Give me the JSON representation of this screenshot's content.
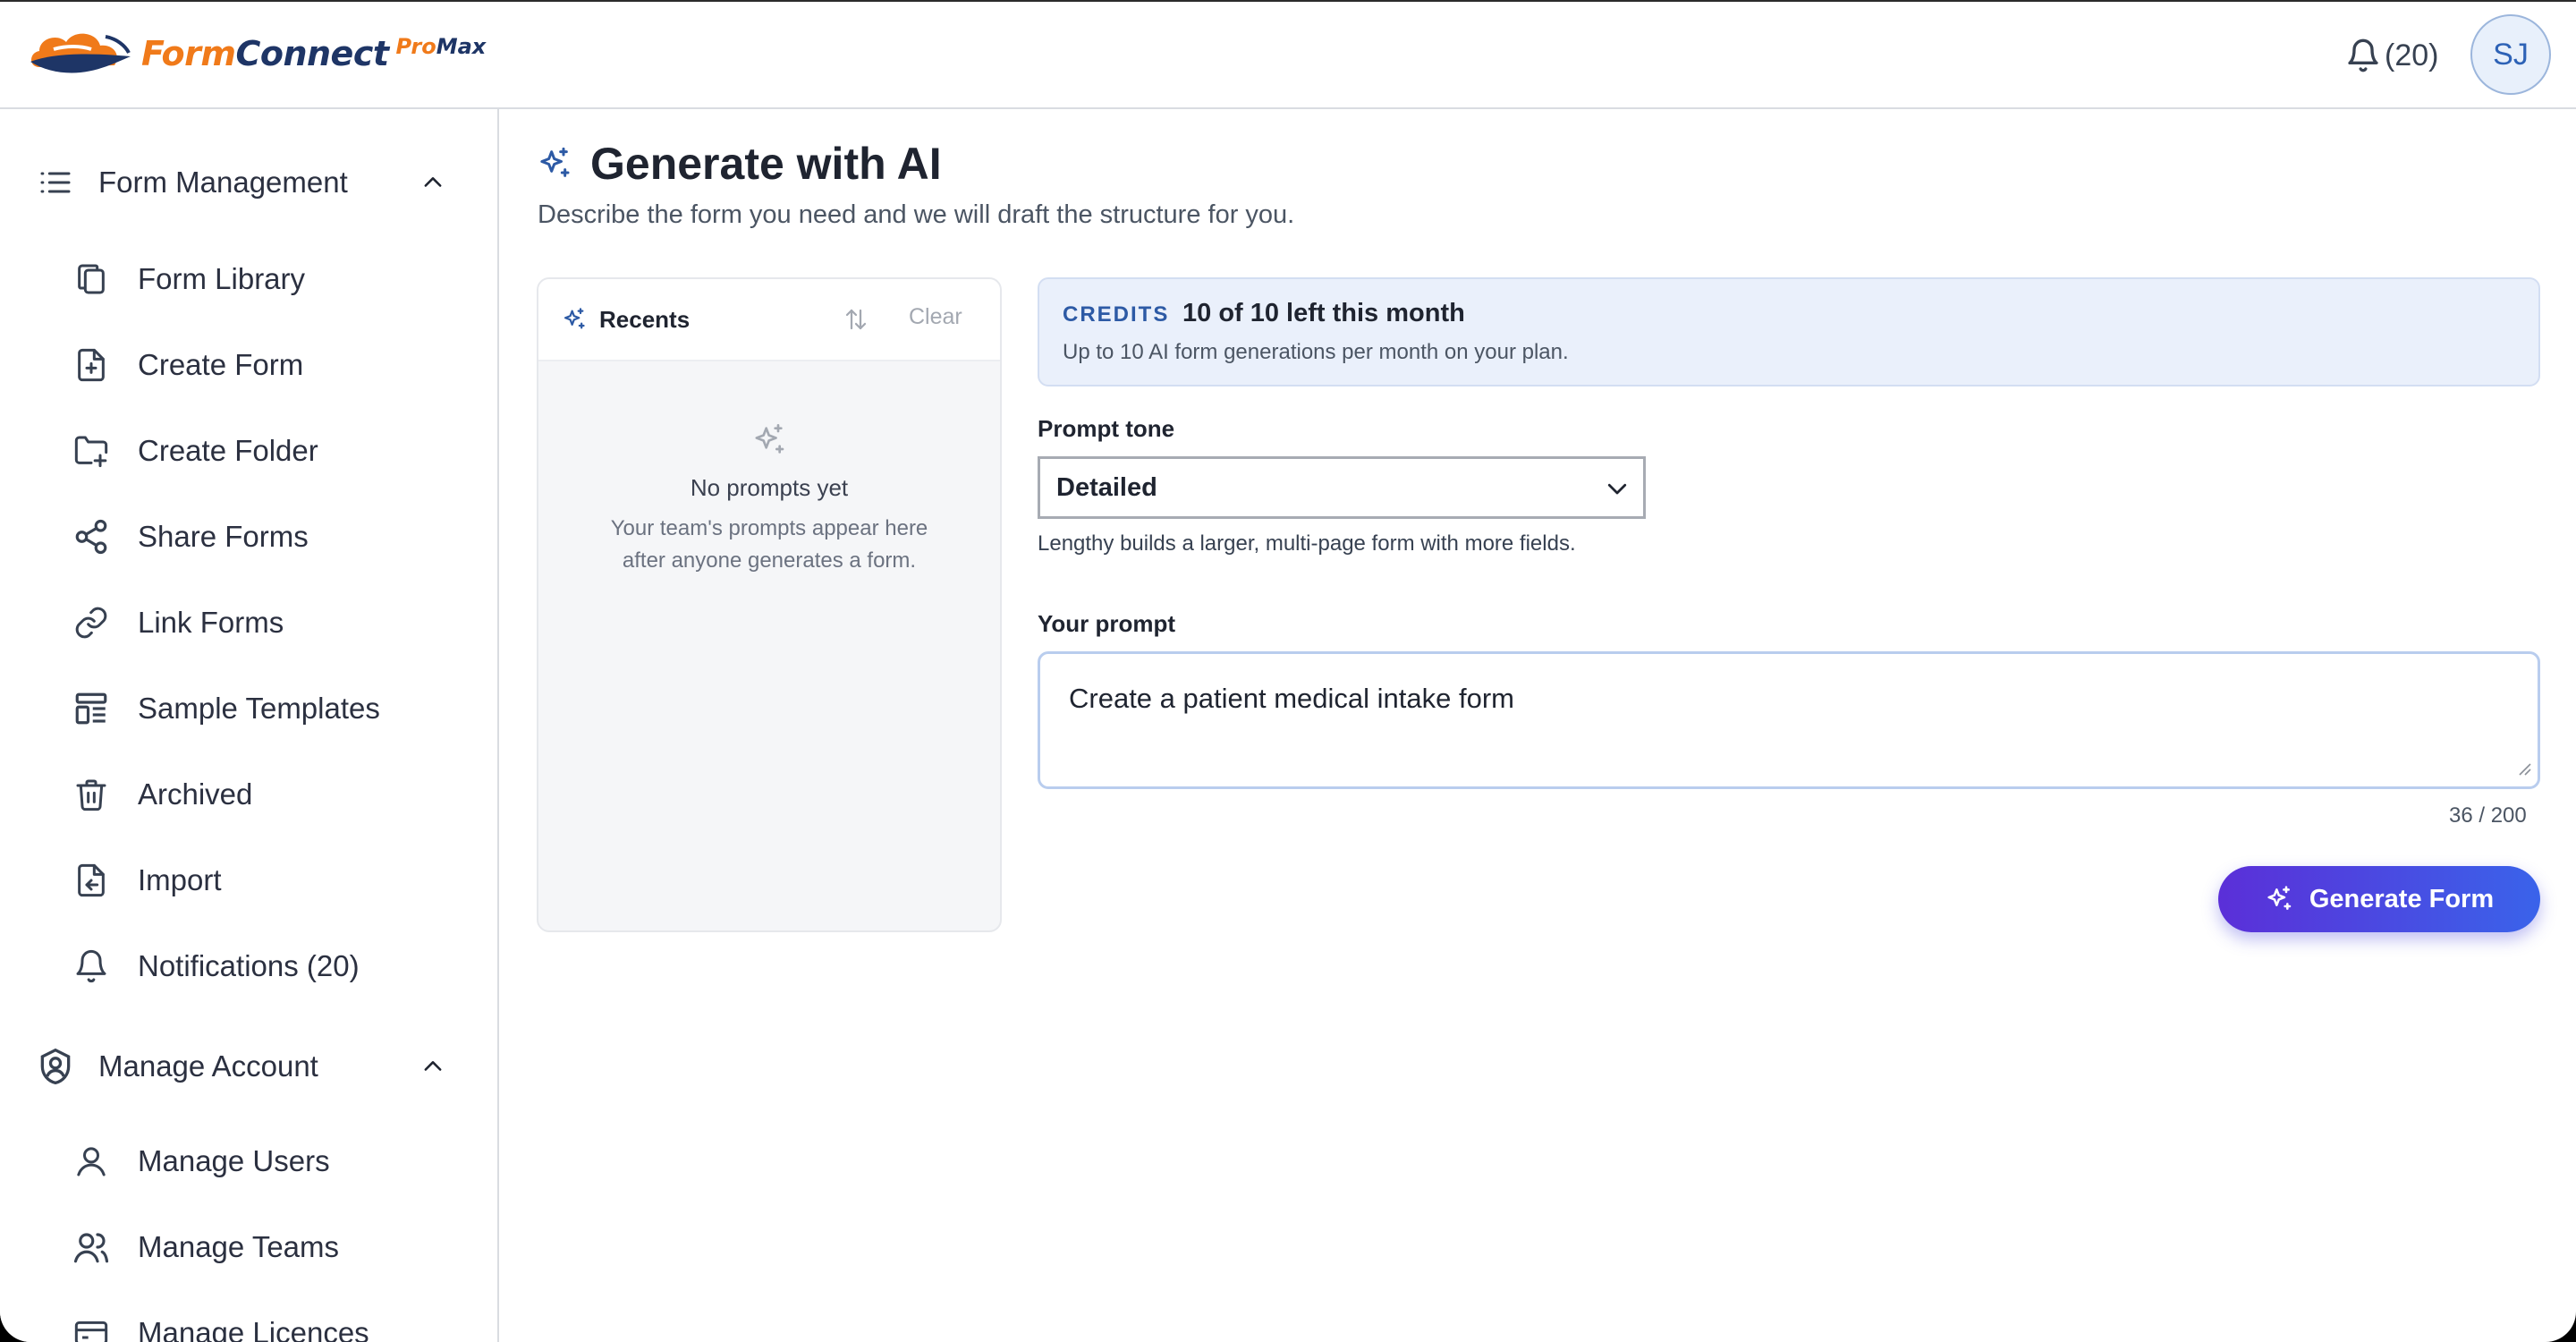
{
  "app": {
    "logo_form": "Form",
    "logo_connect": "Connect",
    "logo_pro": "Pro",
    "logo_max": "Max",
    "brand_orange": "#f07a1a",
    "brand_navy": "#1e3566"
  },
  "header": {
    "notification_count": "(20)",
    "avatar_initials": "SJ"
  },
  "sidebar": {
    "form_management": {
      "label": "Form Management",
      "items": [
        {
          "label": "Form Library",
          "icon": "copy-icon"
        },
        {
          "label": "Create Form",
          "icon": "file-plus-icon"
        },
        {
          "label": "Create Folder",
          "icon": "folder-plus-icon"
        },
        {
          "label": "Share Forms",
          "icon": "share-icon"
        },
        {
          "label": "Link Forms",
          "icon": "link-icon"
        },
        {
          "label": "Sample Templates",
          "icon": "template-icon"
        },
        {
          "label": "Archived",
          "icon": "trash-icon"
        },
        {
          "label": "Import",
          "icon": "import-icon"
        },
        {
          "label": "Notifications (20)",
          "icon": "bell-icon"
        }
      ]
    },
    "manage_account": {
      "label": "Manage Account",
      "items": [
        {
          "label": "Manage Users",
          "icon": "user-icon"
        },
        {
          "label": "Manage Teams",
          "icon": "users-icon"
        },
        {
          "label": "Manage Licences",
          "icon": "card-icon"
        }
      ]
    }
  },
  "main": {
    "title": "Generate with AI",
    "subtitle": "Describe the form you need and we will draft the structure for you.",
    "recents": {
      "title": "Recents",
      "clear_label": "Clear",
      "empty_title": "No prompts yet",
      "empty_line1": "Your team's prompts appear here",
      "empty_line2": "after anyone generates a form."
    },
    "credits": {
      "tag": "CREDITS",
      "main": "10 of 10 left this month",
      "sub": "Up to 10 AI form generations per month on your plan."
    },
    "tone": {
      "label": "Prompt tone",
      "value": "Detailed",
      "helper": "Lengthy builds a larger, multi-page form with more fields."
    },
    "prompt": {
      "label": "Your prompt",
      "value": "Create a patient medical intake form",
      "counter": "36 / 200"
    },
    "generate_label": "Generate Form",
    "accent": "#2d5aa5"
  }
}
